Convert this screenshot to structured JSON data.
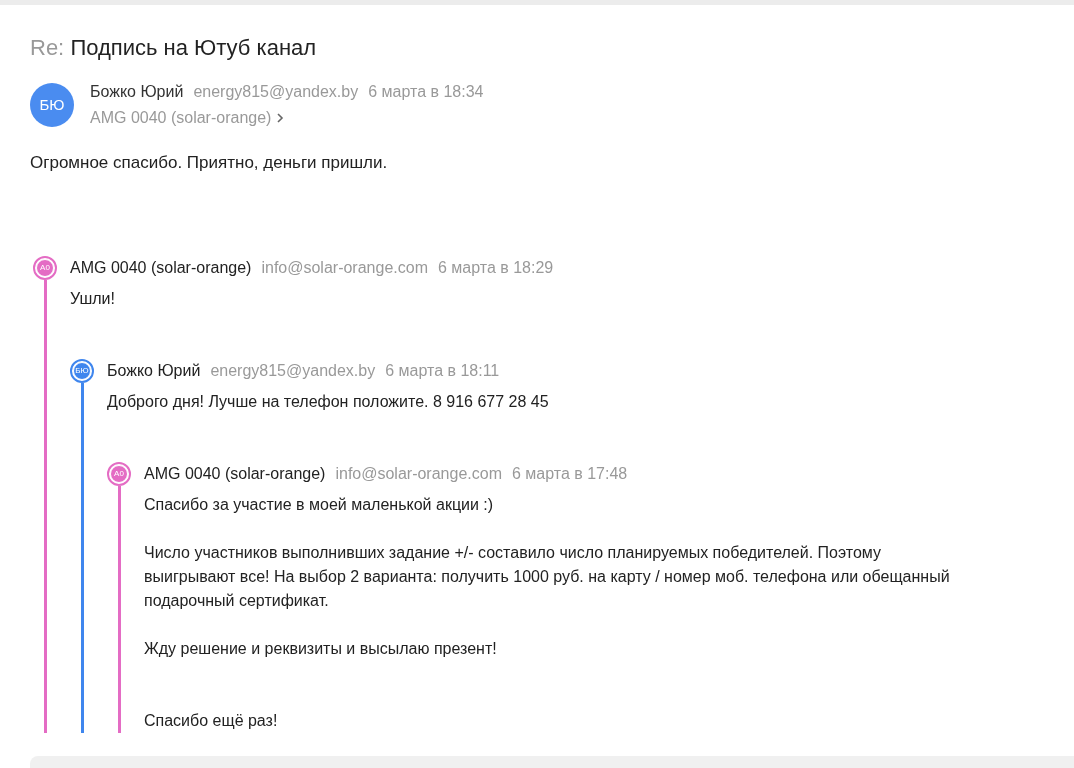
{
  "subject": {
    "prefix": "Re:",
    "text": "Подпись на Ютуб канал"
  },
  "message": {
    "avatar": "БЮ",
    "color": "#4a8cf0",
    "sender": "Божко Юрий",
    "email": "energy815@yandex.by",
    "date": "6 марта в 18:34",
    "recipient": "AMG 0040 (solar-orange)",
    "body": "Огромное спасибо. Приятно, деньги пришли."
  },
  "thread": {
    "avatar": "A0",
    "color": "#e46cc4",
    "sender": "AMG 0040 (solar-orange)",
    "email": "info@solar-orange.com",
    "date": "6 марта в 18:29",
    "body": "Ушли!",
    "children": [
      {
        "avatar": "БЮ",
        "color": "#3f86ee",
        "sender": "Божко Юрий",
        "email": "energy815@yandex.by",
        "date": "6 марта в 18:11",
        "body": "Доброго дня! Лучше на телефон положите. 8 916 677 28 45",
        "children": [
          {
            "avatar": "A0",
            "color": "#e46cc4",
            "sender": "AMG 0040 (solar-orange)",
            "email": "info@solar-orange.com",
            "date": "6 марта в 17:48",
            "body": "Спасибо за участие в моей маленькой акции :)\n\nЧисло участников выполнивших задание +/- составило число планируемых победителей. Поэтому выигрывают все! На выбор 2 варианта: получить 1000 руб. на карту / номер моб. телефона или обещанный подарочный сертификат.\n\nЖду решение и реквизиты и высылаю презент!\n\n\nСпасибо ещё раз!"
          }
        ]
      }
    ]
  }
}
